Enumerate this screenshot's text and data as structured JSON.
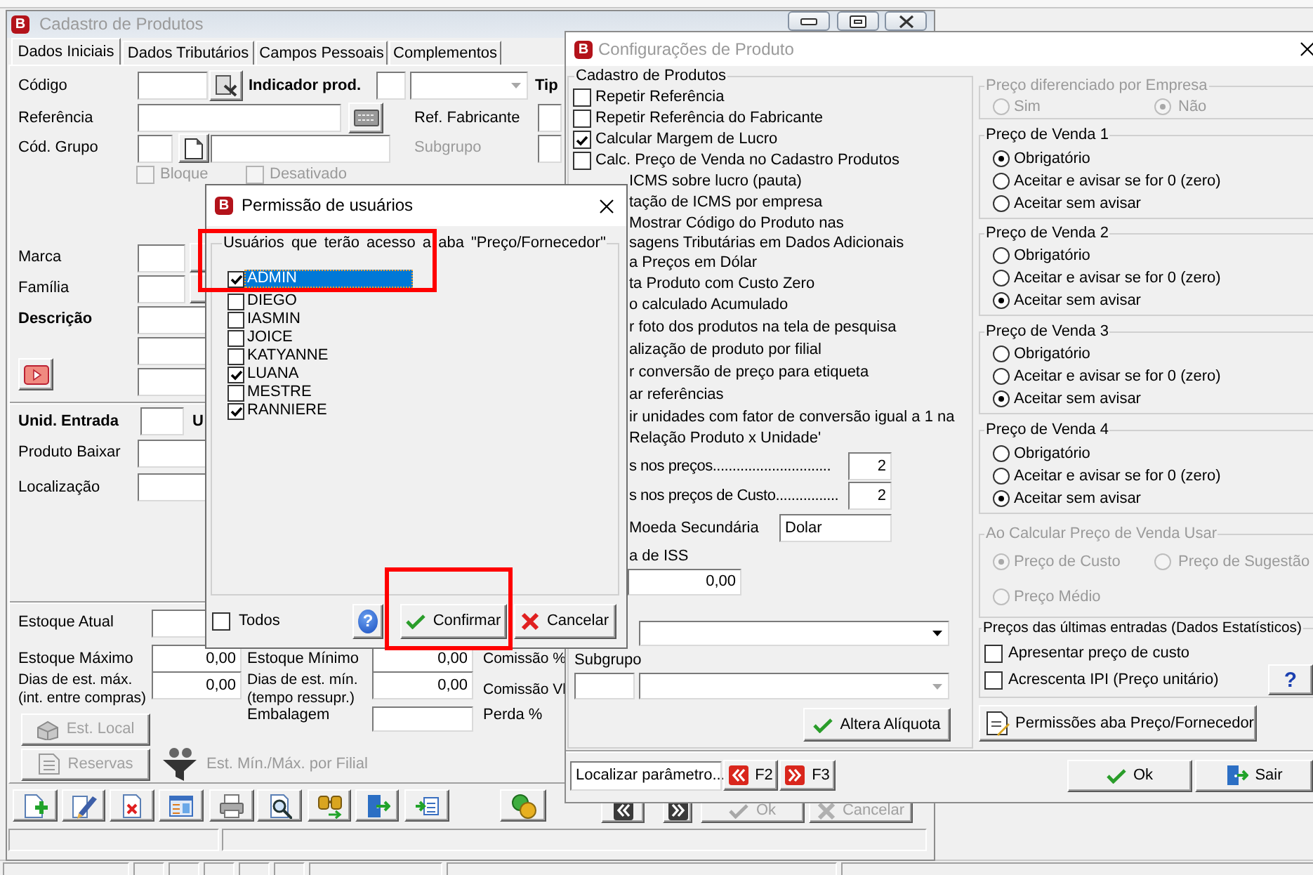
{
  "cadastro_window": {
    "logo": "B",
    "title": "Cadastro de Produtos",
    "active": false,
    "tabs": [
      {
        "label": "Dados Iniciais",
        "selected": true
      },
      {
        "label": "Dados Tributários",
        "selected": false
      },
      {
        "label": "Campos Pessoais",
        "selected": false
      },
      {
        "label": "Complementos",
        "selected": false
      }
    ],
    "fields": {
      "codigo": "Código",
      "indicador_prod": "Indicador prod.",
      "tipo": "Tip",
      "referencia": "Referência",
      "ref_fabricante": "Ref. Fabricante",
      "cod_grupo": "Cód. Grupo",
      "marca": "Marca",
      "familia": "Família",
      "descricao": "Descrição",
      "unid_entrada": "Unid. Entrada",
      "column_2": "U",
      "produto_baixar": "Produto Baixar",
      "localizacao": "Localização",
      "estoque_atual": "Estoque Atual"
    },
    "indicador_combo": {
      "disabled": true
    },
    "subgrupo": {
      "label": "Subgrupo",
      "disabled": true
    },
    "flags": [
      {
        "label": "Bloque",
        "checked": false,
        "disabled": true
      },
      {
        "label": "Desativado",
        "checked": false,
        "disabled": true
      }
    ],
    "stock": {
      "estoque_maximo": {
        "label": "Estoque Máximo",
        "value": "0,00"
      },
      "estoque_minimo": {
        "label": "Estoque Mínimo",
        "value": "0,00"
      },
      "comissao_pct": "Comissão %",
      "dias_max": {
        "label": "Dias de est. máx.\n(int. entre compras)",
        "value": "0,00"
      },
      "dias_min": {
        "label": "Dias de est. mín.\n(tempo ressupr.)",
        "value": "0,00"
      },
      "comissao_vl": "Comissão Vl",
      "embalagem": "Embalagem",
      "perda": "Perda %"
    },
    "est_local_button": {
      "label": "Est. Local",
      "disabled": true
    },
    "reservas_button": {
      "label": "Reservas",
      "disabled": true
    },
    "filial_link": {
      "label": "Est. Mín./Máx. por Filial",
      "disabled": true
    },
    "ok_button": {
      "label": "Ok",
      "disabled": true
    },
    "cancel_button": {
      "label": "Cancelar",
      "disabled": true
    }
  },
  "config_window": {
    "logo": "B",
    "title": "Configurações de Produto",
    "active": false,
    "product_group": {
      "title": "Cadastro de Produtos",
      "options": [
        {
          "kind": "check",
          "label": "Repetir Referência",
          "checked": false
        },
        {
          "kind": "check",
          "label": "Repetir Referência do Fabricante",
          "checked": false
        },
        {
          "kind": "check",
          "label": "Calcular Margem de Lucro",
          "checked": true
        },
        {
          "kind": "check",
          "label": "Calc. Preço de Venda no Cadastro Produtos",
          "checked": false
        },
        {
          "kind": "covered",
          "label": "ICMS sobre lucro (pauta)"
        },
        {
          "kind": "covered",
          "label": "tação de ICMS por empresa"
        },
        {
          "kind": "covered",
          "label": "Mostrar Código do Produto nas\nsagens Tributárias em Dados Adicionais"
        },
        {
          "kind": "covered",
          "label": "a Preços em Dólar"
        },
        {
          "kind": "covered",
          "label": "ta Produto com Custo Zero"
        },
        {
          "kind": "covered",
          "label": "o calculado Acumulado"
        },
        {
          "kind": "covered",
          "label": "r foto dos produtos na tela de pesquisa"
        },
        {
          "kind": "covered",
          "label": "alização de produto por filial"
        },
        {
          "kind": "covered",
          "label": "r conversão de preço para etiqueta"
        },
        {
          "kind": "covered",
          "label": "ar referências"
        },
        {
          "kind": "covered",
          "label": "ir unidades com fator de conversão igual a 1 na\nRelação Produto x Unidade'"
        }
      ]
    },
    "decimals": [
      {
        "label": "s nos preços..............................",
        "value": "2"
      },
      {
        "label": "s nos preços de Custo................",
        "value": "2"
      }
    ],
    "currency": {
      "label": "Moeda Secundária",
      "value": "Dolar"
    },
    "iss": {
      "label": "a de ISS",
      "value": "0,00"
    },
    "group_combo": {
      "disabled": false
    },
    "subgroup": {
      "label": "Subgrupo",
      "combo_disabled": true
    },
    "rate_button": "Altera Alíquota",
    "search_field": {
      "value": "Localizar parâmetro..."
    },
    "prev_button": "F2",
    "next_button": "F3",
    "company_price": {
      "title": "Preço diferenciado por Empresa",
      "disabled": true,
      "options": [
        {
          "label": "Sim",
          "selected": false
        },
        {
          "label": "Não",
          "selected": true
        }
      ]
    },
    "sale_prices": [
      {
        "title": "Preço de Venda 1",
        "options": [
          {
            "label": "Obrigatório",
            "selected": true
          },
          {
            "label": "Aceitar e avisar se for 0 (zero)",
            "selected": false
          },
          {
            "label": "Aceitar sem avisar",
            "selected": false
          }
        ]
      },
      {
        "title": "Preço de Venda 2",
        "options": [
          {
            "label": "Obrigatório",
            "selected": false
          },
          {
            "label": "Aceitar e avisar se for 0 (zero)",
            "selected": false
          },
          {
            "label": "Aceitar sem avisar",
            "selected": true
          }
        ]
      },
      {
        "title": "Preço de Venda 3",
        "options": [
          {
            "label": "Obrigatório",
            "selected": false
          },
          {
            "label": "Aceitar e avisar se for 0 (zero)",
            "selected": false
          },
          {
            "label": "Aceitar sem avisar",
            "selected": true
          }
        ]
      },
      {
        "title": "Preço de Venda 4",
        "options": [
          {
            "label": "Obrigatório",
            "selected": false
          },
          {
            "label": "Aceitar e avisar se for 0 (zero)",
            "selected": false
          },
          {
            "label": "Aceitar sem avisar",
            "selected": true
          }
        ]
      }
    ],
    "calc_base": {
      "title": "Ao Calcular Preço de Venda Usar",
      "disabled": true,
      "options": [
        {
          "label": "Preço de Custo",
          "selected": true
        },
        {
          "label": "Preço de Sugestão",
          "selected": false
        },
        {
          "label": "Preço Médio",
          "selected": false
        }
      ]
    },
    "last_entries": {
      "title": "Preços das últimas entradas (Dados Estatísticos)",
      "options": [
        {
          "label": "Apresentar preço de custo",
          "checked": false
        },
        {
          "label": "Acrescenta IPI (Preço unitário)",
          "checked": false
        }
      ],
      "help_button": "?"
    },
    "permissions_button": "Permissões aba Preço/Fornecedor",
    "ok_button": "Ok",
    "exit_button": "Sair"
  },
  "permission_dialog": {
    "logo": "B",
    "title": "Permissão de usuários",
    "active": true,
    "group_title": "Usuários que terão acesso a aba \"Preço/Fornecedor\"",
    "users": [
      {
        "name": "ADMIN",
        "checked": true,
        "selected": true
      },
      {
        "name": "DIEGO",
        "checked": false,
        "selected": false
      },
      {
        "name": "IASMIN",
        "checked": false,
        "selected": false
      },
      {
        "name": "JOICE",
        "checked": false,
        "selected": false
      },
      {
        "name": "KATYANNE",
        "checked": false,
        "selected": false
      },
      {
        "name": "LUANA",
        "checked": true,
        "selected": false
      },
      {
        "name": "MESTRE",
        "checked": false,
        "selected": false
      },
      {
        "name": "RANNIERE",
        "checked": true,
        "selected": false
      }
    ],
    "select_all": {
      "label": "Todos",
      "checked": false
    },
    "help_button": "?",
    "confirm_button": "Confirmar",
    "cancel_button": "Cancelar"
  },
  "annotations": [
    {
      "kind": "frame"
    },
    {
      "kind": "frame"
    }
  ]
}
